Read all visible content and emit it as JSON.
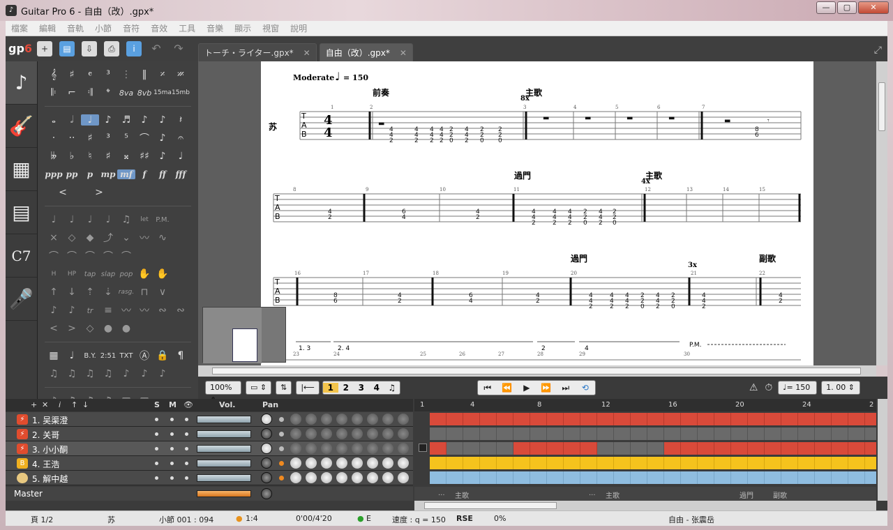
{
  "window": {
    "title": "Guitar Pro 6 - 自由（改）.gpx*",
    "icon": "guitar-pick-icon",
    "minimize": "—",
    "maximize": "▢",
    "close": "✕"
  },
  "menu": [
    "檔案",
    "編輯",
    "音軌",
    "小節",
    "音符",
    "音效",
    "工具",
    "音樂",
    "顯示",
    "視窗",
    "說明"
  ],
  "toolbar": {
    "logo_a": "gp",
    "logo_b": "6",
    "undo": "↶",
    "redo": "↷",
    "info": "i"
  },
  "tabs": [
    {
      "label": "トーチ・ライター.gpx*",
      "close": "✕"
    },
    {
      "label": "自由（改）.gpx*",
      "close": "✕"
    }
  ],
  "score": {
    "tempo_label": "Moderate",
    "tempo_value": "= 150",
    "track_short": "苏",
    "sections": [
      "前奏",
      "主歌",
      "過門",
      "主歌",
      "過門",
      "副歌"
    ],
    "repeats": [
      "8x",
      "4x",
      "3x"
    ],
    "bar_numbers": [
      "1",
      "2",
      "3",
      "4",
      "5",
      "6",
      "7",
      "8",
      "9",
      "10",
      "11",
      "12",
      "13",
      "14",
      "15",
      "16",
      "17",
      "18",
      "19",
      "20",
      "21",
      "22",
      "23",
      "24",
      "25",
      "26",
      "27",
      "28",
      "29",
      "30"
    ],
    "endings": [
      "1. 3",
      "2. 4",
      "2",
      "4"
    ],
    "pm": "P.M.",
    "tab_letters": [
      "T",
      "A",
      "B"
    ],
    "time_sig": "4"
  },
  "transport": {
    "zoom": "100%",
    "voices": [
      "1",
      "2",
      "3",
      "4"
    ],
    "tempo": "= 150",
    "speed": "1. 00"
  },
  "tracks": {
    "header": {
      "vol": "Vol.",
      "pan": "Pan",
      "s": "S",
      "m": "M"
    },
    "ruler": [
      "1",
      "4",
      "8",
      "12",
      "16",
      "20",
      "24",
      "2"
    ],
    "rows": [
      {
        "name": "1. 吴渠澄",
        "type": "guitar"
      },
      {
        "name": "2. 关哥",
        "type": "guitar"
      },
      {
        "name": "3. 小小酮",
        "type": "guitar"
      },
      {
        "name": "4. 王浩",
        "type": "bass"
      },
      {
        "name": "5. 解中越",
        "type": "drums"
      }
    ],
    "master": "Master",
    "section_markers": [
      "...",
      "主歌",
      "...",
      "主歌",
      "過門",
      "副歌"
    ]
  },
  "status": {
    "page": "頁 1/2",
    "track": "苏",
    "bar": "小節 001 : 094",
    "sig": "1:4",
    "time": "0'00/4'20",
    "key": "E",
    "tempo": "速度 : q = 150",
    "rse": "RSE",
    "rse_pct": "0%",
    "song": "自由 - 张震岳"
  },
  "colors": {
    "accent": "#f3c44b",
    "track_red": "#d94a3a",
    "track_yellow": "#f5c31d",
    "track_blue": "#8fbde0"
  }
}
